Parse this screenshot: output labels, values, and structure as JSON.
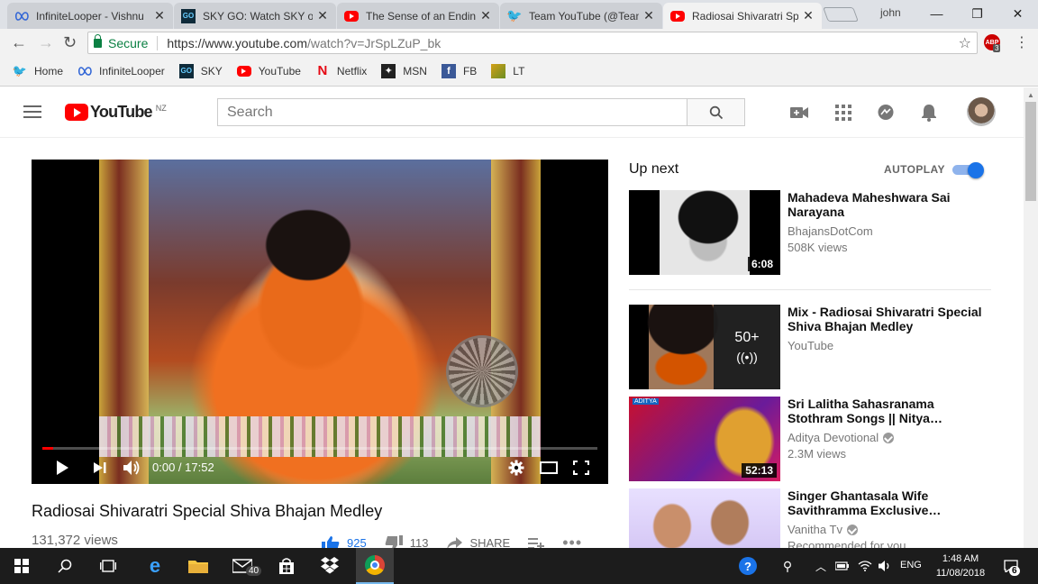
{
  "tabs": [
    {
      "title": "InfiniteLooper - Vishnu",
      "icon": "infinity-icon"
    },
    {
      "title": "SKY GO: Watch SKY on",
      "icon": "skygo-icon"
    },
    {
      "title": "The Sense of an Ending",
      "icon": "youtube-icon"
    },
    {
      "title": "Team YouTube (@Team",
      "icon": "twitter-icon"
    },
    {
      "title": "Radiosai Shivaratri Spe",
      "icon": "youtube-icon"
    }
  ],
  "window": {
    "user": "john"
  },
  "address": {
    "secure_label": "Secure",
    "url_base": "https://www.youtube.com",
    "url_path": "/watch?v=JrSpLZuP_bk",
    "ext_badge": "3"
  },
  "bookmarks": [
    {
      "label": "Home",
      "icon": "twitter-icon"
    },
    {
      "label": "InfiniteLooper",
      "icon": "infinity-icon"
    },
    {
      "label": "SKY",
      "icon": "skygo-icon"
    },
    {
      "label": "YouTube",
      "icon": "youtube-icon"
    },
    {
      "label": "Netflix",
      "icon": "netflix-icon"
    },
    {
      "label": "MSN",
      "icon": "msn-icon"
    },
    {
      "label": "FB",
      "icon": "facebook-icon"
    },
    {
      "label": "LT",
      "icon": "lt-icon"
    }
  ],
  "masthead": {
    "logo_text": "YouTube",
    "region": "NZ",
    "search_placeholder": "Search"
  },
  "player": {
    "time": "0:00 / 17:52",
    "progress": 0.02
  },
  "video": {
    "title": "Radiosai Shivaratri Special Shiva Bhajan Medley",
    "views": "131,372 views",
    "likes": "925",
    "dislikes": "113",
    "share_label": "SHARE"
  },
  "sidebar": {
    "upnext_label": "Up next",
    "autoplay_label": "AUTOPLAY",
    "autoplay_on": true,
    "items": [
      {
        "title": "Mahadeva Maheshwara Sai Narayana",
        "channel": "BhajansDotCom",
        "meta": "508K views",
        "duration": "6:08",
        "verified": false
      },
      {
        "title": "Mix - Radiosai Shivaratri Special Shiva Bhajan Medley",
        "channel": "YouTube",
        "meta": "",
        "playlist_count": "50+",
        "verified": false
      },
      {
        "title": "Sri Lalitha Sahasranama Stothram Songs || Nitya…",
        "channel": "Aditya Devotional",
        "meta": "2.3M views",
        "duration": "52:13",
        "verified": true
      },
      {
        "title": "Singer Ghantasala Wife Savithramma Exclusive…",
        "channel": "Vanitha Tv",
        "meta": "Recommended for you",
        "duration": "",
        "verified": true
      }
    ]
  },
  "taskbar": {
    "time": "1:48 AM",
    "date": "11/08/2018",
    "lang": "ENG",
    "mail_badge": "40",
    "notif_badge": "6"
  },
  "colors": {
    "youtube_red": "#ff0000",
    "accent_blue": "#1a73e8",
    "secure_green": "#0b8043",
    "taskbar": "#1c1c1c"
  }
}
